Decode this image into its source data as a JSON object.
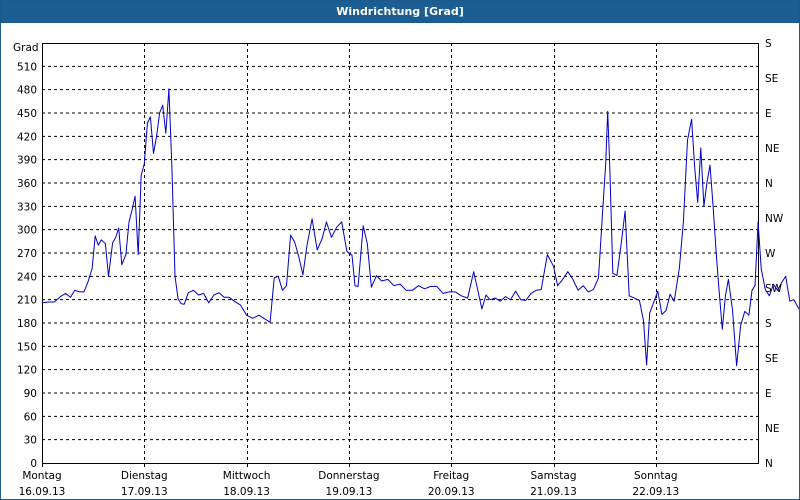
{
  "chart_data": {
    "type": "line",
    "title": "Windrichtung [Grad]",
    "ylabel": "Grad",
    "ylim": [
      0,
      540
    ],
    "yticks": [
      0,
      30,
      60,
      90,
      120,
      150,
      180,
      210,
      240,
      270,
      300,
      330,
      360,
      390,
      420,
      450,
      480,
      510
    ],
    "right_axis_labels": [
      "N",
      "NE",
      "E",
      "SE",
      "S",
      "SW",
      "W",
      "NW",
      "N",
      "NE",
      "E",
      "SE",
      "S"
    ],
    "x_categories": [
      {
        "day": "Montag",
        "date": "16.09.13"
      },
      {
        "day": "Dienstag",
        "date": "17.09.13"
      },
      {
        "day": "Mittwoch",
        "date": "18.09.13"
      },
      {
        "day": "Donnerstag",
        "date": "19.09.13"
      },
      {
        "day": "Freitag",
        "date": "20.09.13"
      },
      {
        "day": "Samstag",
        "date": "21.09.13"
      },
      {
        "day": "Sonntag",
        "date": "22.09.13"
      }
    ],
    "xlim_days": [
      0,
      7.05
    ],
    "grid": true,
    "series": [
      {
        "color": "#0000c8",
        "points": [
          [
            0.0,
            206
          ],
          [
            0.06,
            207
          ],
          [
            0.12,
            207
          ],
          [
            0.18,
            214
          ],
          [
            0.23,
            218
          ],
          [
            0.28,
            213
          ],
          [
            0.32,
            222
          ],
          [
            0.37,
            220
          ],
          [
            0.41,
            220
          ],
          [
            0.45,
            233
          ],
          [
            0.49,
            250
          ],
          [
            0.52,
            292
          ],
          [
            0.55,
            280
          ],
          [
            0.58,
            287
          ],
          [
            0.62,
            282
          ],
          [
            0.65,
            240
          ],
          [
            0.69,
            283
          ],
          [
            0.72,
            290
          ],
          [
            0.75,
            302
          ],
          [
            0.78,
            255
          ],
          [
            0.82,
            268
          ],
          [
            0.85,
            310
          ],
          [
            0.88,
            325
          ],
          [
            0.91,
            343
          ],
          [
            0.94,
            268
          ],
          [
            0.97,
            370
          ],
          [
            1.0,
            385
          ],
          [
            1.03,
            437
          ],
          [
            1.06,
            445
          ],
          [
            1.09,
            398
          ],
          [
            1.12,
            420
          ],
          [
            1.15,
            450
          ],
          [
            1.18,
            460
          ],
          [
            1.21,
            424
          ],
          [
            1.24,
            481
          ],
          [
            1.27,
            380
          ],
          [
            1.3,
            240
          ],
          [
            1.33,
            211
          ],
          [
            1.36,
            205
          ],
          [
            1.39,
            204
          ],
          [
            1.43,
            219
          ],
          [
            1.48,
            222
          ],
          [
            1.53,
            216
          ],
          [
            1.58,
            218
          ],
          [
            1.63,
            206
          ],
          [
            1.68,
            216
          ],
          [
            1.73,
            219
          ],
          [
            1.78,
            213
          ],
          [
            1.83,
            213
          ],
          [
            1.88,
            208
          ],
          [
            1.94,
            203
          ],
          [
            2.0,
            190
          ],
          [
            2.06,
            186
          ],
          [
            2.12,
            190
          ],
          [
            2.18,
            185
          ],
          [
            2.23,
            181
          ],
          [
            2.27,
            238
          ],
          [
            2.31,
            240
          ],
          [
            2.35,
            222
          ],
          [
            2.39,
            228
          ],
          [
            2.43,
            293
          ],
          [
            2.47,
            284
          ],
          [
            2.51,
            265
          ],
          [
            2.55,
            242
          ],
          [
            2.59,
            280
          ],
          [
            2.64,
            314
          ],
          [
            2.69,
            274
          ],
          [
            2.74,
            289
          ],
          [
            2.78,
            310
          ],
          [
            2.83,
            290
          ],
          [
            2.88,
            303
          ],
          [
            2.93,
            310
          ],
          [
            2.98,
            272
          ],
          [
            3.03,
            267
          ],
          [
            3.06,
            228
          ],
          [
            3.09,
            227
          ],
          [
            3.14,
            305
          ],
          [
            3.18,
            282
          ],
          [
            3.22,
            226
          ],
          [
            3.27,
            241
          ],
          [
            3.32,
            234
          ],
          [
            3.38,
            236
          ],
          [
            3.44,
            228
          ],
          [
            3.5,
            230
          ],
          [
            3.56,
            222
          ],
          [
            3.62,
            222
          ],
          [
            3.68,
            228
          ],
          [
            3.74,
            224
          ],
          [
            3.8,
            227
          ],
          [
            3.86,
            227
          ],
          [
            3.92,
            218
          ],
          [
            3.98,
            220
          ],
          [
            4.04,
            220
          ],
          [
            4.1,
            215
          ],
          [
            4.16,
            212
          ],
          [
            4.22,
            246
          ],
          [
            4.26,
            222
          ],
          [
            4.3,
            198
          ],
          [
            4.34,
            216
          ],
          [
            4.38,
            210
          ],
          [
            4.43,
            212
          ],
          [
            4.48,
            208
          ],
          [
            4.53,
            214
          ],
          [
            4.58,
            210
          ],
          [
            4.63,
            221
          ],
          [
            4.68,
            210
          ],
          [
            4.73,
            209
          ],
          [
            4.78,
            218
          ],
          [
            4.83,
            222
          ],
          [
            4.88,
            223
          ],
          [
            4.94,
            268
          ],
          [
            5.0,
            253
          ],
          [
            5.04,
            228
          ],
          [
            5.09,
            236
          ],
          [
            5.14,
            246
          ],
          [
            5.19,
            236
          ],
          [
            5.24,
            222
          ],
          [
            5.29,
            228
          ],
          [
            5.34,
            220
          ],
          [
            5.39,
            223
          ],
          [
            5.44,
            238
          ],
          [
            5.48,
            323
          ],
          [
            5.51,
            385
          ],
          [
            5.53,
            452
          ],
          [
            5.55,
            380
          ],
          [
            5.58,
            244
          ],
          [
            5.62,
            241
          ],
          [
            5.66,
            280
          ],
          [
            5.7,
            324
          ],
          [
            5.74,
            215
          ],
          [
            5.79,
            212
          ],
          [
            5.84,
            209
          ],
          [
            5.88,
            183
          ],
          [
            5.91,
            126
          ],
          [
            5.94,
            193
          ],
          [
            5.98,
            207
          ],
          [
            6.02,
            221
          ],
          [
            6.06,
            191
          ],
          [
            6.1,
            196
          ],
          [
            6.14,
            217
          ],
          [
            6.18,
            208
          ],
          [
            6.23,
            250
          ],
          [
            6.27,
            310
          ],
          [
            6.31,
            415
          ],
          [
            6.35,
            442
          ],
          [
            6.38,
            380
          ],
          [
            6.41,
            335
          ],
          [
            6.44,
            405
          ],
          [
            6.47,
            330
          ],
          [
            6.5,
            360
          ],
          [
            6.53,
            383
          ],
          [
            6.56,
            330
          ],
          [
            6.59,
            270
          ],
          [
            6.62,
            220
          ],
          [
            6.65,
            172
          ],
          [
            6.68,
            215
          ],
          [
            6.71,
            236
          ],
          [
            6.75,
            197
          ],
          [
            6.79,
            125
          ],
          [
            6.83,
            177
          ],
          [
            6.87,
            195
          ],
          [
            6.91,
            190
          ],
          [
            6.94,
            222
          ],
          [
            6.97,
            228
          ],
          [
            7.0,
            310
          ],
          [
            7.03,
            250
          ],
          [
            7.07,
            223
          ],
          [
            7.11,
            215
          ],
          [
            7.15,
            230
          ],
          [
            7.19,
            222
          ],
          [
            7.23,
            232
          ],
          [
            7.27,
            240
          ],
          [
            7.31,
            208
          ],
          [
            7.35,
            210
          ],
          [
            7.4,
            198
          ],
          [
            7.44,
            210
          ]
        ]
      }
    ]
  }
}
